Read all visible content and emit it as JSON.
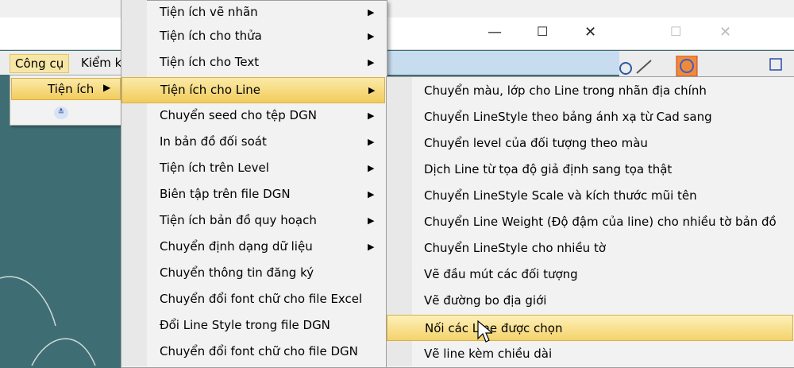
{
  "menubar": {
    "congcu": "Công cụ",
    "kiemtra": "Kiểm k"
  },
  "left_menu": {
    "tienich": "Tiện ích",
    "more_icon": "double-chevron-down"
  },
  "main_menu": {
    "items": [
      {
        "label": "Tiện ích vẽ nhãn",
        "submenu": true
      },
      {
        "label": "Tiện ích cho thửa",
        "submenu": true
      },
      {
        "label": "Tiện ích cho Text",
        "submenu": true
      },
      {
        "label": "Tiện ích cho Line",
        "submenu": true,
        "highlighted": true
      },
      {
        "label": "Chuyển seed cho tệp DGN",
        "submenu": true
      },
      {
        "label": "In bản đồ đối soát",
        "submenu": true
      },
      {
        "label": "Tiện ích trên Level",
        "submenu": true
      },
      {
        "label": "Biên tập trên file DGN",
        "submenu": true
      },
      {
        "label": "Tiện ích bản đồ quy hoạch",
        "submenu": true
      },
      {
        "label": "Chuyển định dạng dữ liệu",
        "submenu": true
      },
      {
        "label": "Chuyển thông tin đăng ký",
        "submenu": false
      },
      {
        "label": "Chuyển đổi font chữ cho file Excel",
        "submenu": false
      },
      {
        "label": "Đổi Line Style trong file DGN",
        "submenu": false
      },
      {
        "label": "Chuyển đổi font chữ cho file DGN",
        "submenu": false
      }
    ]
  },
  "sub_menu": {
    "items": [
      {
        "label": "Chuyển màu, lớp cho Line trong nhãn địa chính"
      },
      {
        "label": "Chuyển LineStyle theo bảng ánh xạ từ Cad sang"
      },
      {
        "label": "Chuyển level của đối tượng theo màu"
      },
      {
        "label": "Dịch Line từ tọa độ giả định sang tọa thật"
      },
      {
        "label": "Chuyển LineStyle Scale và kích thước mũi tên"
      },
      {
        "label": "Chuyển Line Weight (Độ đậm của line) cho nhiều tờ bản đồ"
      },
      {
        "label": "Chuyển LineStyle cho nhiều tờ"
      },
      {
        "label": "Vẽ đầu mút các đối  tượng"
      },
      {
        "label": "Vẽ đường bo địa giới"
      },
      {
        "label": "Nối các Line được chọn",
        "highlighted": true
      },
      {
        "label": "Vẽ line kèm chiều dài"
      }
    ]
  },
  "colors": {
    "highlight": "#f2cc5c",
    "canvas": "#3e6e73",
    "menu_bg": "#f2f2f2"
  }
}
